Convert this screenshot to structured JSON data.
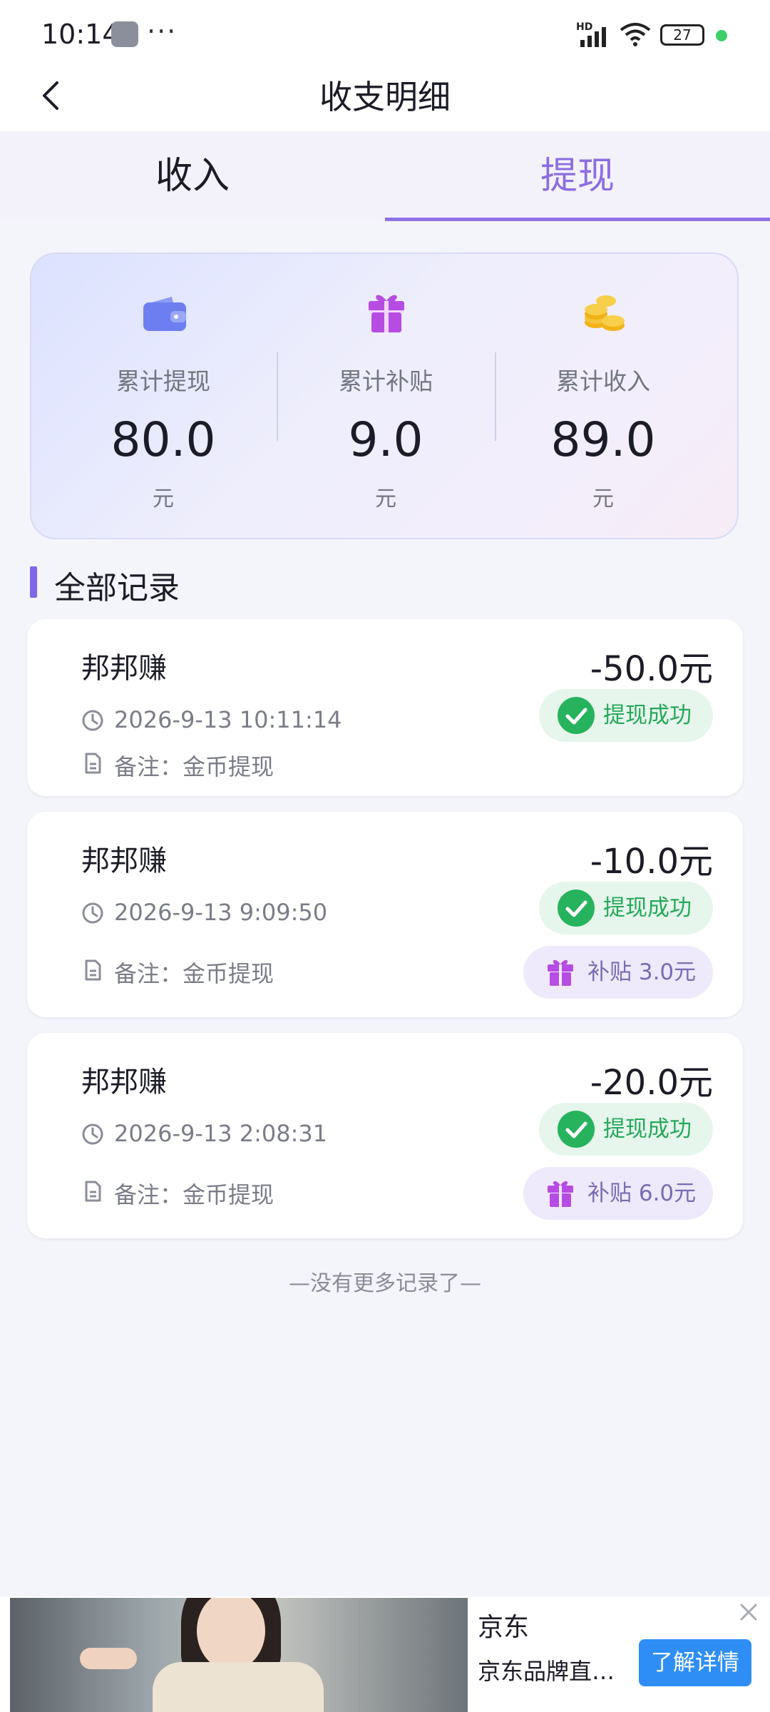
{
  "status_bar": {
    "time": "10:14",
    "battery": "27",
    "network": "HD"
  },
  "header": {
    "title": "收支明细"
  },
  "tabs": [
    {
      "label": "收入",
      "active": false
    },
    {
      "label": "提现",
      "active": true
    }
  ],
  "summary": {
    "items": [
      {
        "icon": "wallet-icon",
        "label": "累计提现",
        "value": "80.0",
        "unit": "元"
      },
      {
        "icon": "gift-icon",
        "label": "累计补贴",
        "value": "9.0",
        "unit": "元"
      },
      {
        "icon": "coins-icon",
        "label": "累计收入",
        "value": "89.0",
        "unit": "元"
      }
    ]
  },
  "section": {
    "title": "全部记录"
  },
  "records": [
    {
      "source": "邦邦赚",
      "amount": "-50.0元",
      "time": "2026-9-13 10:11:14",
      "note": "备注：金币提现",
      "status": "提现成功",
      "subsidy": null
    },
    {
      "source": "邦邦赚",
      "amount": "-10.0元",
      "time": "2026-9-13 9:09:50",
      "note": "备注：金币提现",
      "status": "提现成功",
      "subsidy": "补贴 3.0元"
    },
    {
      "source": "邦邦赚",
      "amount": "-20.0元",
      "time": "2026-9-13 2:08:31",
      "note": "备注：金币提现",
      "status": "提现成功",
      "subsidy": "补贴 6.0元"
    }
  ],
  "footer": {
    "no_more": "—没有更多记录了—"
  },
  "ad": {
    "brand": "京东",
    "description": "京东品牌直…",
    "cta": "了解详情"
  },
  "colors": {
    "accent": "#8c72e4",
    "success": "#26a85a",
    "success_bg": "#e6f6ec",
    "subsidy_bg": "#eeeafb",
    "cta": "#2e8ef5"
  }
}
